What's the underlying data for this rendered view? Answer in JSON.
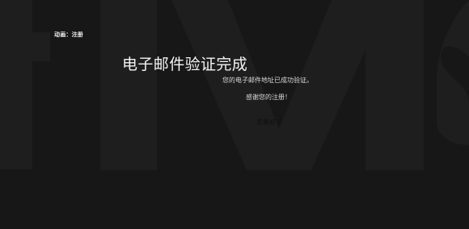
{
  "breadcrumb": {
    "text": "动画：注册"
  },
  "main": {
    "title": "电子邮件验证完成",
    "verified_message": "您的电子邮件地址已成功验证。",
    "thanks_message": "感谢您的注册！",
    "action_link": "准备好了"
  },
  "background": {
    "watermark_text": "tIVIS",
    "color": "#161716",
    "watermark_color": "#1d1e1d"
  }
}
